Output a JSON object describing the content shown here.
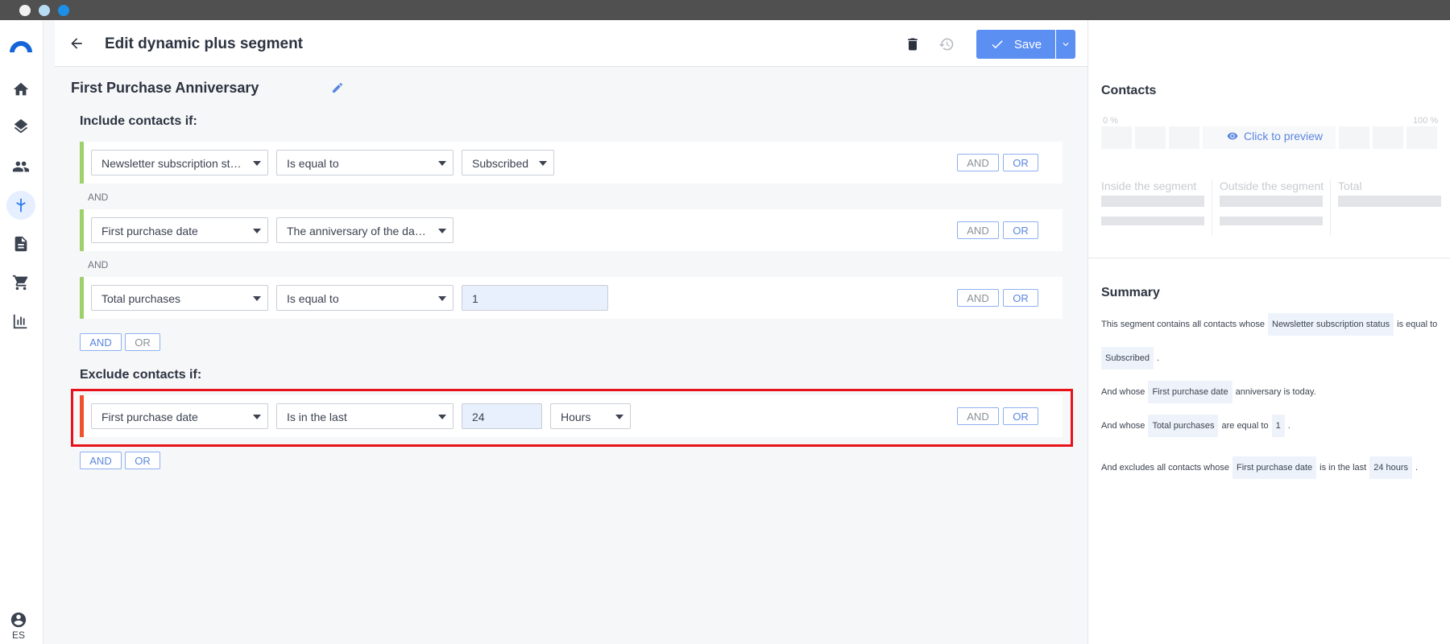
{
  "header": {
    "title": "Edit dynamic plus segment",
    "save_label": "Save"
  },
  "sidebar": {
    "items": [
      "home-icon",
      "layers-icon",
      "contacts-icon",
      "segments-icon",
      "document-icon",
      "cart-icon",
      "reports-icon"
    ],
    "active": "segments-icon",
    "lang": "ES"
  },
  "segment": {
    "name": "First Purchase Anniversary"
  },
  "include": {
    "title": "Include contacts if:",
    "conditions": [
      {
        "field": "Newsletter subscription status",
        "operator": "Is equal to",
        "value": "Subscribed"
      },
      {
        "field": "First purchase date",
        "operator": "The anniversary of the date ..."
      },
      {
        "field": "Total purchases",
        "operator": "Is equal to",
        "value": "1"
      }
    ],
    "joiner": "AND"
  },
  "exclude": {
    "title": "Exclude contacts if:",
    "conditions": [
      {
        "field": "First purchase date",
        "operator": "Is in the last",
        "value": "24",
        "unit": "Hours"
      }
    ]
  },
  "buttons": {
    "and": "AND",
    "or": "OR"
  },
  "contacts_panel": {
    "title": "Contacts",
    "pct_min": "0 %",
    "pct_max": "100 %",
    "preview": "Click to preview",
    "inside": "Inside the segment",
    "outside": "Outside the segment",
    "total": "Total"
  },
  "summary": {
    "title": "Summary",
    "line1_pre": "This segment contains all contacts whose",
    "line1_chip": "Newsletter subscription status",
    "line1_post": "is equal to",
    "line2_chip": "Subscribed",
    "line2_post": ".",
    "line3_pre": "And whose",
    "line3_chip": "First purchase date",
    "line3_post": "anniversary is today.",
    "line4_pre": "And whose",
    "line4_chip": "Total purchases",
    "line4_mid": "are equal to",
    "line4_chip2": "1",
    "line4_post": ".",
    "line5_pre": "And excludes all contacts whose",
    "line5_chip": "First purchase date",
    "line5_mid": "is in the last",
    "line5_chip2": "24 hours",
    "line5_post": "."
  },
  "colors": {
    "accent": "#5c8ff2",
    "include_bar": "#9fd16b",
    "exclude_bar": "#f0522b",
    "highlight": "#e8121a"
  }
}
